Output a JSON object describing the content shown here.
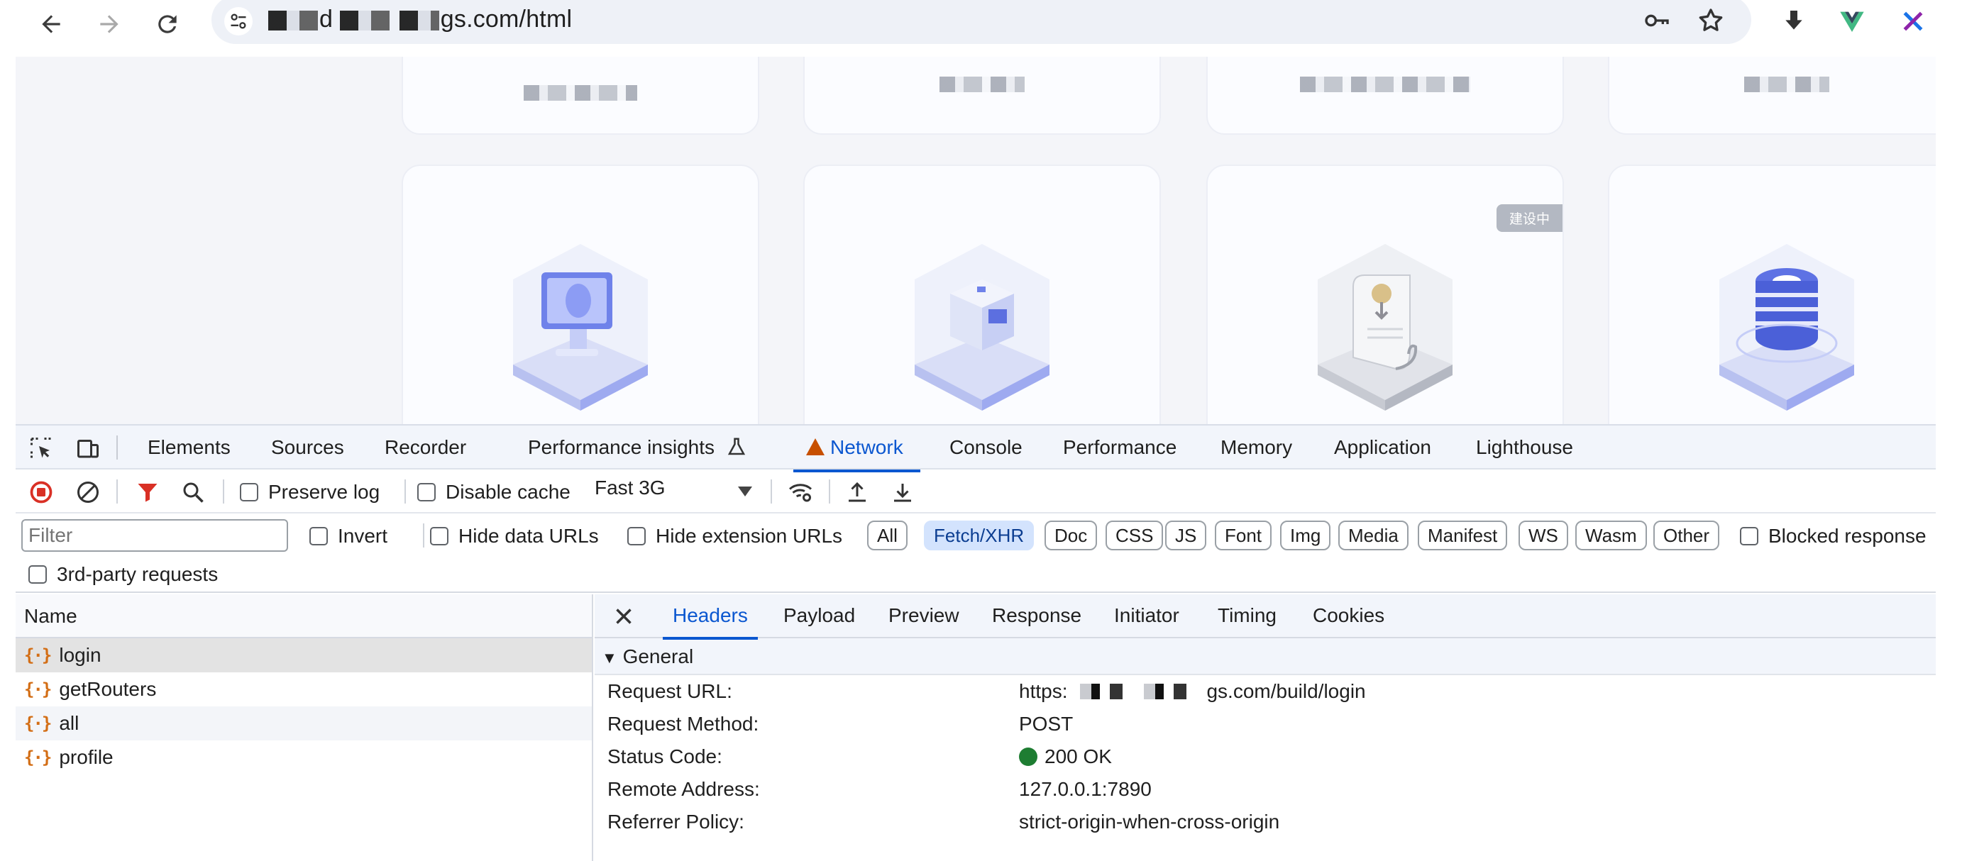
{
  "browser": {
    "url_visible_prefix": "d",
    "url_visible_suffix": "gs.com/html"
  },
  "page": {
    "badge": "建设中"
  },
  "devtools": {
    "tabs": [
      "Elements",
      "Sources",
      "Recorder",
      "Performance insights",
      "Network",
      "Console",
      "Performance",
      "Memory",
      "Application",
      "Lighthouse"
    ],
    "active_tab": "Network",
    "toolbar": {
      "preserve_log": "Preserve log",
      "disable_cache": "Disable cache",
      "throttling": "Fast 3G"
    },
    "filter": {
      "placeholder": "Filter",
      "invert": "Invert",
      "hide_data_urls": "Hide data URLs",
      "hide_extension_urls": "Hide extension URLs",
      "types": [
        "All",
        "Fetch/XHR",
        "Doc",
        "CSS",
        "JS",
        "Font",
        "Img",
        "Media",
        "Manifest",
        "WS",
        "Wasm",
        "Other"
      ],
      "active_type": "Fetch/XHR",
      "blocked": "Blocked response",
      "third_party": "3rd-party requests"
    },
    "requests": {
      "column_name": "Name",
      "items": [
        "login",
        "getRouters",
        "all",
        "profile"
      ]
    },
    "detail": {
      "tabs": [
        "Headers",
        "Payload",
        "Preview",
        "Response",
        "Initiator",
        "Timing",
        "Cookies"
      ],
      "active_tab": "Headers",
      "section": "General",
      "general": {
        "request_url_label": "Request URL:",
        "request_url_prefix": "https:",
        "request_url_suffix": "gs.com/build/login",
        "request_method_label": "Request Method:",
        "request_method": "POST",
        "status_code_label": "Status Code:",
        "status_code": "200 OK",
        "remote_address_label": "Remote Address:",
        "remote_address": "127.0.0.1:7890",
        "referrer_policy_label": "Referrer Policy:",
        "referrer_policy": "strict-origin-when-cross-origin"
      }
    }
  },
  "colors": {
    "accent": "#0b57d0",
    "record": "#d93025",
    "filter_icon": "#d93025",
    "status_ok": "#1e7d32",
    "warning": "#c75000",
    "xhr_icon": "#d36e16"
  }
}
